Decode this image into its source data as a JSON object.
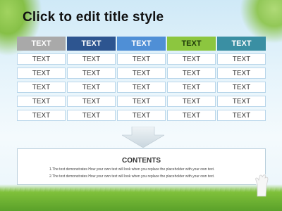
{
  "slide": {
    "title": "Click to edit title style"
  },
  "table": {
    "headers": [
      {
        "label": "TEXT",
        "color": "#a9a9a9"
      },
      {
        "label": "TEXT",
        "color": "#2d5590"
      },
      {
        "label": "TEXT",
        "color": "#4f8fd6"
      },
      {
        "label": "TEXT",
        "color": "#8cc63f"
      },
      {
        "label": "TEXT",
        "color": "#3a8fa3"
      }
    ],
    "rows": [
      [
        "TEXT",
        "TEXT",
        "TEXT",
        "TEXT",
        "TEXT"
      ],
      [
        "TEXT",
        "TEXT",
        "TEXT",
        "TEXT",
        "TEXT"
      ],
      [
        "TEXT",
        "TEXT",
        "TEXT",
        "TEXT",
        "TEXT"
      ],
      [
        "TEXT",
        "TEXT",
        "TEXT",
        "TEXT",
        "TEXT"
      ],
      [
        "TEXT",
        "TEXT",
        "TEXT",
        "TEXT",
        "TEXT"
      ]
    ]
  },
  "contents": {
    "title": "CONTENTS",
    "lines": [
      "1.The text demonstrates How your own text will look when you replace the placeholder with your own text.",
      "2.The text demonstrates How your own text will look when you replace the placeholder with your own text."
    ]
  },
  "decor": {
    "arrow_icon": "down-arrow-icon",
    "glove_icon": "white-glove-icon"
  }
}
